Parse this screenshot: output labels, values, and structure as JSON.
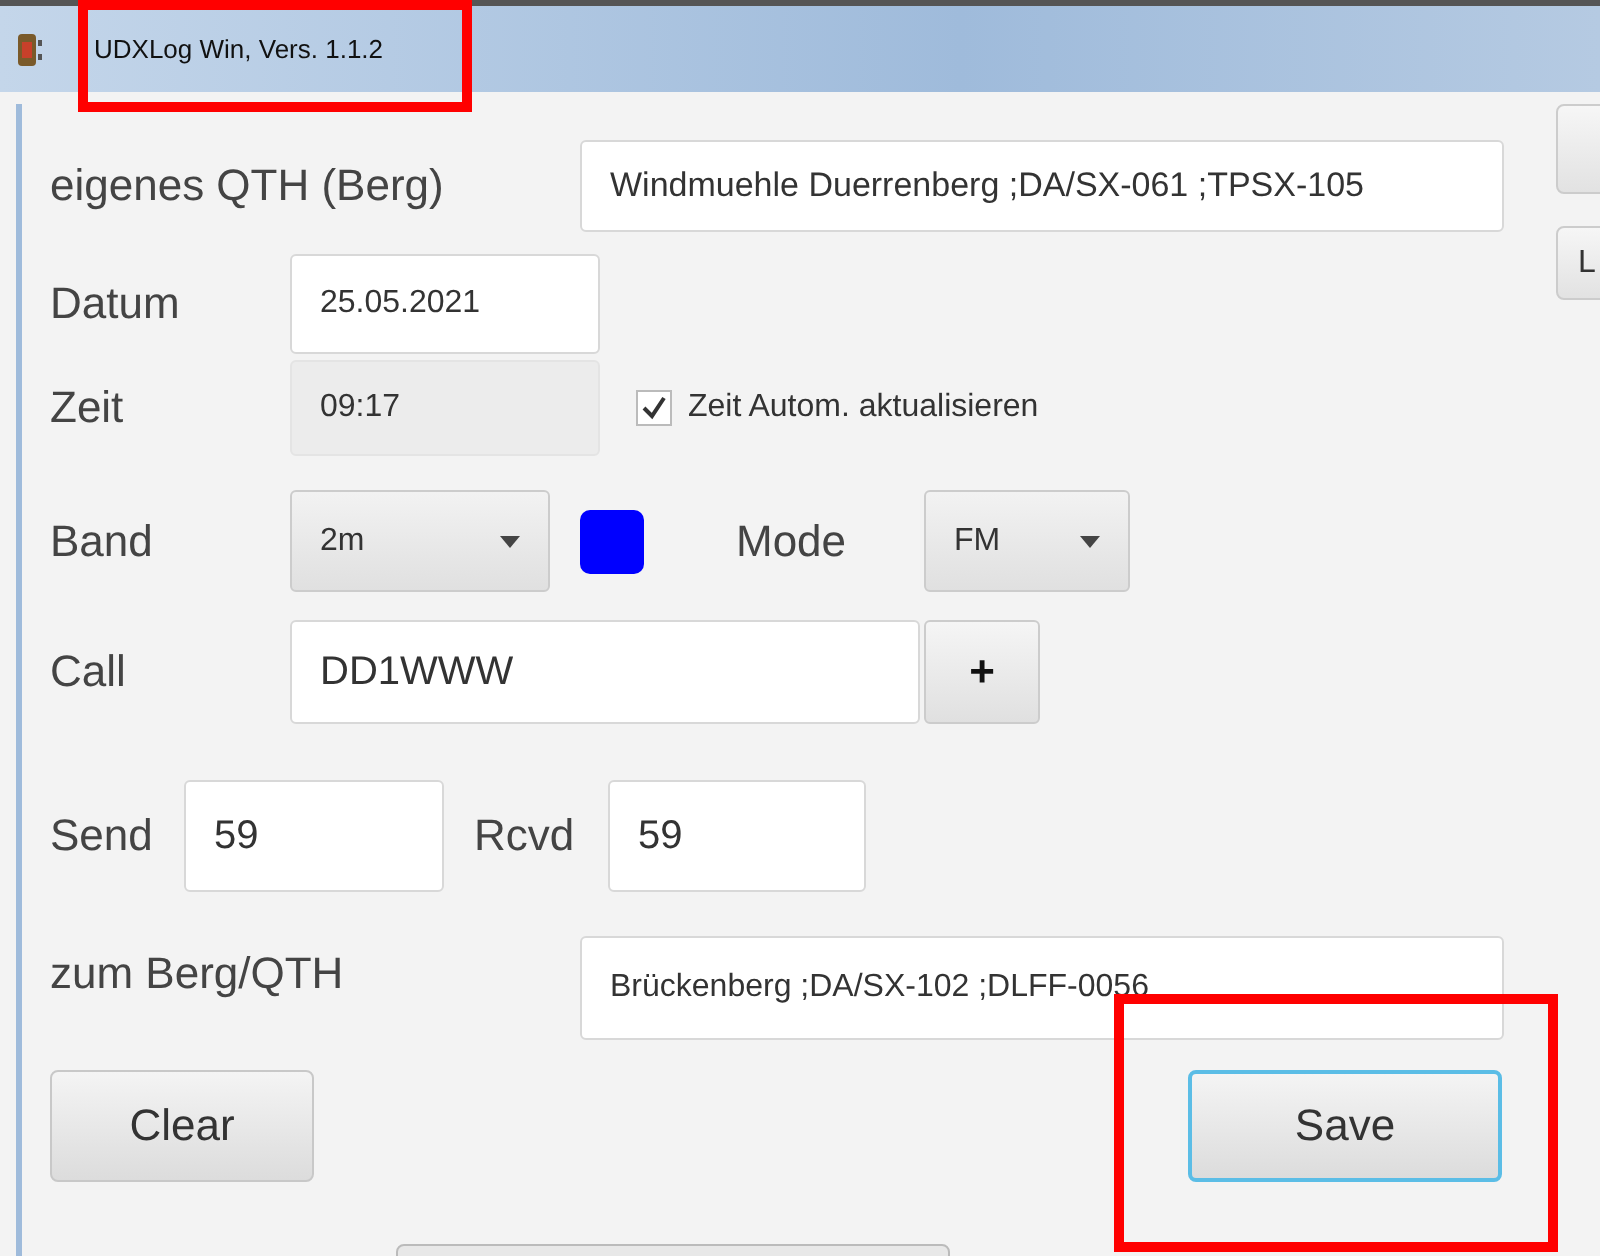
{
  "window": {
    "title": "UDXLog Win, Vers. 1.1.2"
  },
  "own_qth": {
    "label": "eigenes QTH (Berg)",
    "value": "Windmuehle Duerrenberg ;DA/SX-061 ;TPSX-105"
  },
  "side_buttons": [
    "L"
  ],
  "date": {
    "label": "Datum",
    "value": "25.05.2021"
  },
  "time": {
    "label": "Zeit",
    "value": "09:17",
    "disabled": true,
    "auto_update": {
      "label": "Zeit Autom. aktualisieren",
      "checked": true
    }
  },
  "band": {
    "label": "Band",
    "value": "2m",
    "color": "#0000ff"
  },
  "mode": {
    "label": "Mode",
    "value": "FM"
  },
  "call": {
    "label": "Call",
    "value": "DD1WWW",
    "add_button": "+"
  },
  "send": {
    "label": "Send",
    "value": "59"
  },
  "rcvd": {
    "label": "Rcvd",
    "value": "59"
  },
  "to_qth": {
    "label": "zum Berg/QTH",
    "value": "Brückenberg ;DA/SX-102 ;DLFF-0056"
  },
  "buttons": [
    {
      "label": "Clear",
      "focused": false
    },
    {
      "label": "Save",
      "focused": true
    }
  ]
}
